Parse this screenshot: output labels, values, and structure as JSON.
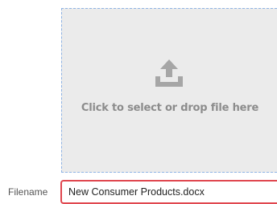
{
  "dropzone": {
    "label": "Click to select or drop file here",
    "icon": "upload-icon"
  },
  "filename": {
    "label": "Filename",
    "value": "New Consumer Products.docx"
  },
  "colors": {
    "dropzone_bg": "#ebebeb",
    "dropzone_border": "#8fb3e4",
    "icon": "#a6a6a6",
    "input_border_error": "#e0474f"
  }
}
